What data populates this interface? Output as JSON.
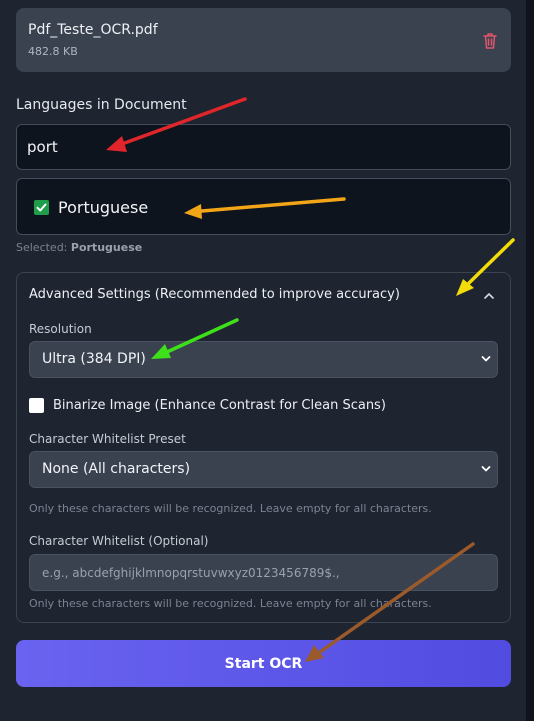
{
  "file": {
    "name": "Pdf_Teste_OCR.pdf",
    "size": "482.8 KB"
  },
  "languages": {
    "label": "Languages in Document",
    "input_value": "port",
    "option_label": "Portuguese",
    "selected_prefix": "Selected:",
    "selected_value": "Portuguese"
  },
  "advanced": {
    "title": "Advanced Settings (Recommended to improve accuracy)",
    "resolution_label": "Resolution",
    "resolution_value": "Ultra (384 DPI)",
    "binarize_label": "Binarize Image (Enhance Contrast for Clean Scans)",
    "whitelist_preset_label": "Character Whitelist Preset",
    "whitelist_preset_value": "None (All characters)",
    "preset_hint": "Only these characters will be recognized. Leave empty for all characters.",
    "whitelist_label": "Character Whitelist (Optional)",
    "whitelist_placeholder": "e.g., abcdefghijklmnopqrstuvwxyz0123456789$.,",
    "whitelist_hint": "Only these characters will be recognized. Leave empty for all characters."
  },
  "start_button": "Start OCR",
  "colors": {
    "background": "#1e2430",
    "accent": "#5b55e8",
    "checkbox_checked": "#1f9d4a",
    "delete_icon": "#e0566a",
    "annotation_arrows": [
      "#e0262a",
      "#f2a516",
      "#f2dc0a",
      "#3ee01a",
      "#9a5a2a"
    ]
  },
  "icons": {
    "delete": "trash-icon",
    "collapse": "chevron-up-icon",
    "select": "chevron-down-icon",
    "checked": "checkmark-icon"
  }
}
